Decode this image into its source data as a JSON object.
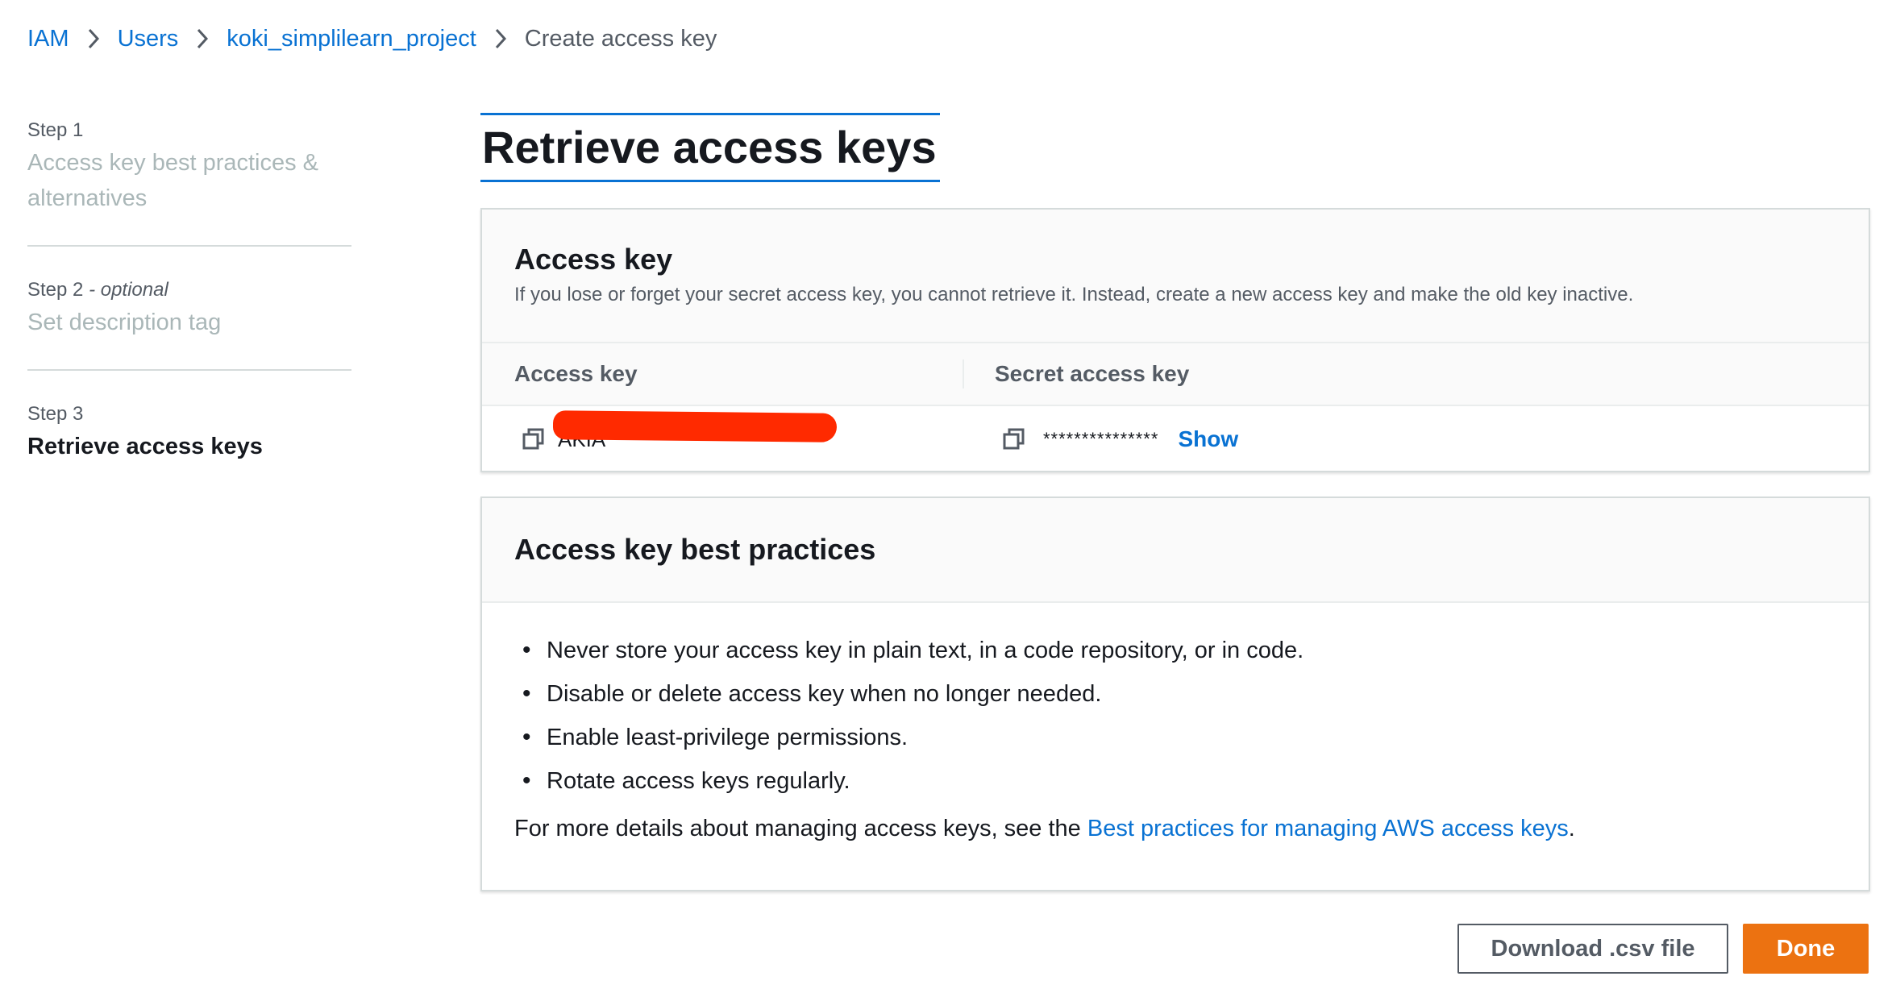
{
  "breadcrumb": {
    "items": [
      {
        "label": "IAM"
      },
      {
        "label": "Users"
      },
      {
        "label": "koki_simplilearn_project"
      }
    ],
    "current": "Create access key"
  },
  "steps": [
    {
      "number": "Step 1",
      "title": "Access key best practices & alternatives",
      "optional": ""
    },
    {
      "number": "Step 2",
      "optional": "- optional",
      "title": "Set description tag"
    },
    {
      "number": "Step 3",
      "title": "Retrieve access keys",
      "optional": ""
    }
  ],
  "page_title": "Retrieve access keys",
  "access_key_panel": {
    "title": "Access key",
    "description": "If you lose or forget your secret access key, you cannot retrieve it. Instead, create a new access key and make the old key inactive.",
    "col_access_key": "Access key",
    "col_secret_key": "Secret access key",
    "access_key_value": "AKIA",
    "secret_value": "***************",
    "show_label": "Show"
  },
  "best_practices_panel": {
    "title": "Access key best practices",
    "items": [
      "Never store your access key in plain text, in a code repository, or in code.",
      "Disable or delete access key when no longer needed.",
      "Enable least-privilege permissions.",
      "Rotate access keys regularly."
    ],
    "more_prefix": "For more details about managing access keys, see the ",
    "more_link": "Best practices for managing AWS access keys",
    "more_suffix": "."
  },
  "buttons": {
    "download": "Download .csv file",
    "done": "Done"
  },
  "colors": {
    "link": "#0972d3",
    "primary": "#ec7211",
    "redaction": "#ff2a00"
  },
  "icons": {
    "separator": "chevron-right-icon",
    "copy": "copy-icon"
  }
}
